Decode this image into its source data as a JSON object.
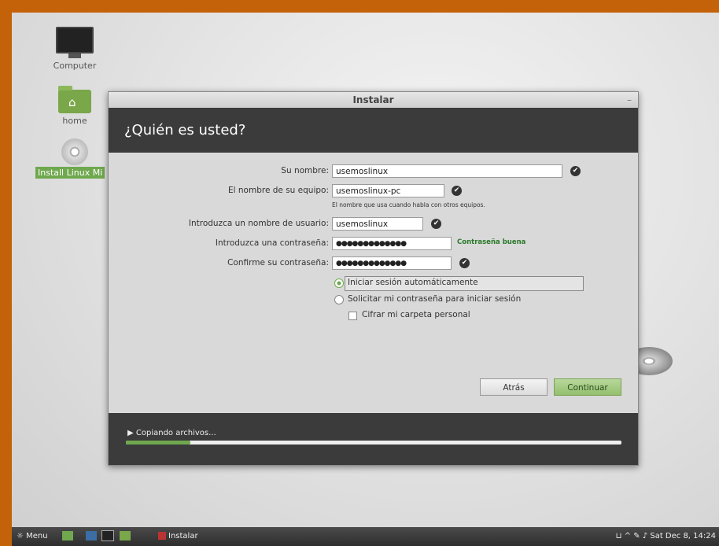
{
  "desktop": {
    "icons": [
      {
        "label": "Computer",
        "icon": "monitor-icon"
      },
      {
        "label": "home",
        "icon": "home-folder-icon"
      },
      {
        "label": "Install Linux Mi",
        "icon": "disc-icon"
      }
    ]
  },
  "window": {
    "title": "Instalar",
    "minimize_glyph": "–",
    "heading": "¿Quién es usted?",
    "fields": {
      "name": {
        "label": "Su nombre:",
        "value": "usemoslinux"
      },
      "computer": {
        "label": "El nombre de su equipo:",
        "value": "usemoslinux-pc",
        "hint": "El nombre que usa cuando habla con otros equipos."
      },
      "username": {
        "label": "Introduzca un nombre de usuario:",
        "value": "usemoslinux"
      },
      "password": {
        "label": "Introduzca una contraseña:",
        "value": "●●●●●●●●●●●●●",
        "strength": "Contraseña buena"
      },
      "confirm": {
        "label": "Confirme su contraseña:",
        "value": "●●●●●●●●●●●●●"
      }
    },
    "login_options": {
      "auto": "Iniciar sesión automáticamente",
      "ask": "Solicitar mi contraseña para iniciar sesión",
      "encrypt": "Cifrar mi carpeta personal",
      "selected": "auto"
    },
    "buttons": {
      "back": "Atrás",
      "continue": "Continuar"
    },
    "progress": {
      "label": "Copiando archivos...",
      "fraction": 0.13
    }
  },
  "taskbar": {
    "menu": "Menu",
    "window": "Instalar",
    "clock": "Sat Dec  8, 14:24"
  },
  "colors": {
    "accent": "#6fa84e",
    "header": "#3b3b3b",
    "frame": "#c4620a"
  }
}
